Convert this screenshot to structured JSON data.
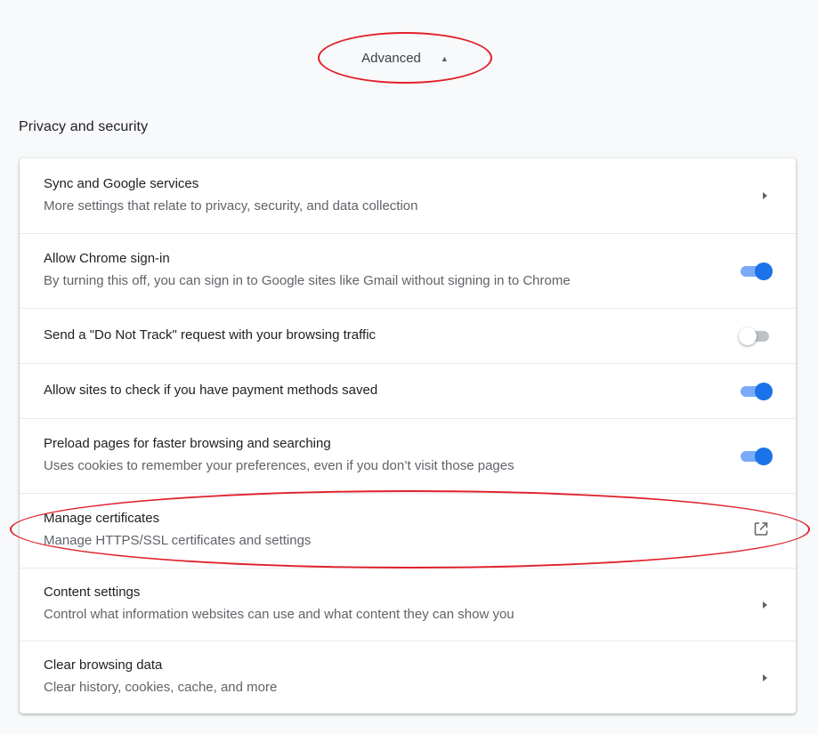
{
  "advanced": {
    "label": "Advanced",
    "expanded": true,
    "caret_icon": "caret-up-icon"
  },
  "section": {
    "title": "Privacy and security"
  },
  "annotation_color": "#e0202a",
  "accent_color": "#1a73e8",
  "rows": [
    {
      "label": "Sync and Google services",
      "sublabel": "More settings that relate to privacy, security, and data collection",
      "control": "arrow"
    },
    {
      "label": "Allow Chrome sign-in",
      "sublabel": "By turning this off, you can sign in to Google sites like Gmail without signing in to Chrome",
      "control": "toggle",
      "checked": true
    },
    {
      "label": "Send a \"Do Not Track\" request with your browsing traffic",
      "control": "toggle",
      "checked": false
    },
    {
      "label": "Allow sites to check if you have payment methods saved",
      "control": "toggle",
      "checked": true
    },
    {
      "label": "Preload pages for faster browsing and searching",
      "sublabel": "Uses cookies to remember your preferences, even if you don’t visit those pages",
      "control": "toggle",
      "checked": true
    },
    {
      "label": "Manage certificates",
      "sublabel": "Manage HTTPS/SSL certificates and settings",
      "control": "external-link"
    },
    {
      "label": "Content settings",
      "sublabel": "Control what information websites can use and what content they can show you",
      "control": "arrow"
    },
    {
      "label": "Clear browsing data",
      "sublabel": "Clear history, cookies, cache, and more",
      "control": "arrow"
    }
  ]
}
